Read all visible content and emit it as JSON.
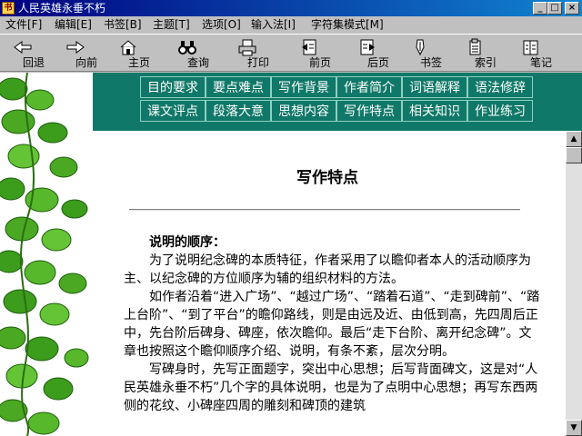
{
  "window": {
    "title": "人民英雄永垂不朽",
    "minimize_glyph": "_",
    "maximize_glyph": "□",
    "close_glyph": "×"
  },
  "menu": [
    {
      "label": "文件[F]"
    },
    {
      "label": "编辑[E]"
    },
    {
      "label": "书签[B]"
    },
    {
      "label": "主题[T]"
    },
    {
      "label": "选项[O]"
    },
    {
      "label": "输入法[I]"
    },
    {
      "label": "字符集模式[M]"
    }
  ],
  "toolbar": [
    {
      "label": "回退",
      "icon": "back-arrow-icon"
    },
    {
      "label": "向前",
      "icon": "forward-arrow-icon"
    },
    {
      "label": "主页",
      "icon": "home-icon"
    },
    {
      "label": "查询",
      "icon": "binoculars-icon"
    },
    {
      "label": "打印",
      "icon": "printer-icon"
    },
    {
      "label": "前页",
      "icon": "prev-page-icon"
    },
    {
      "label": "后页",
      "icon": "next-page-icon"
    },
    {
      "label": "书签",
      "icon": "bookmark-icon"
    },
    {
      "label": "索引",
      "icon": "index-icon"
    },
    {
      "label": "笔记",
      "icon": "notes-icon"
    }
  ],
  "nav": {
    "row1": [
      "目的要求",
      "要点难点",
      "写作背景",
      "作者简介",
      "词语解释",
      "语法修辞"
    ],
    "row2": [
      "课文评点",
      "段落大意",
      "思想内容",
      "写作特点",
      "相关知识",
      "作业练习"
    ]
  },
  "article": {
    "heading": "写作特点",
    "subheading": "说明的顺序：",
    "paragraphs": [
      "为了说明纪念碑的本质特征，作者采用了以瞻仰者本人的活动顺序为主、以纪念碑的方位顺序为辅的组织材料的方法。",
      "如作者沿着“进入广场”、“越过广场”、“踏着石道”、“走到碑前”、“踏上台阶”、“到了平台”的瞻仰路线，则是由远及近、由低到高，先四周后正中，先台阶后碑身、碑座，依次瞻仰。最后“走下台阶、离开纪念碑”。文章也按照这个瞻仰顺序介绍、说明，有条不紊，层次分明。",
      "写碑身时，先写正面题字，突出中心思想；后写背面碑文，这是对“人民英雄永垂不朽”几个字的具体说明，也是为了点明中心思想；再写东西两侧的花纹、小碑座四周的雕刻和碑顶的建筑"
    ]
  },
  "colors": {
    "title_bar": "#000080",
    "nav_panel": "#107868",
    "leaf_green": "#3c9c1c"
  }
}
